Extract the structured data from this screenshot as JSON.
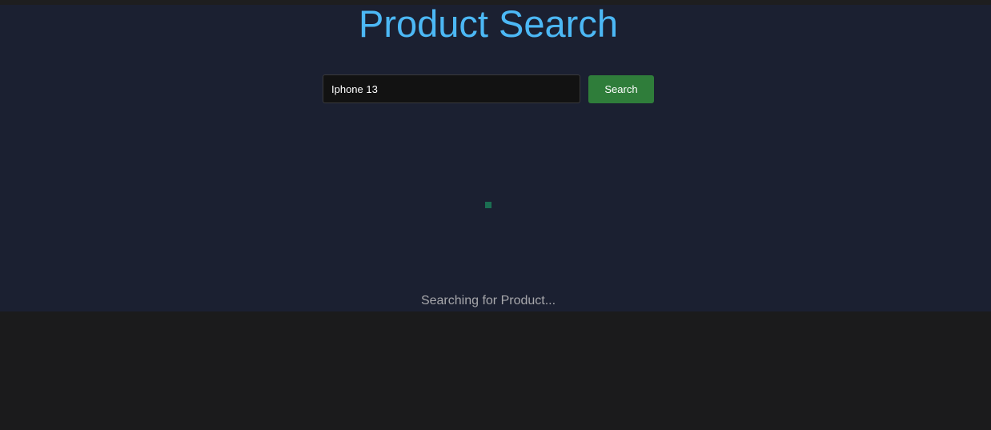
{
  "header": {
    "title": "Product Search"
  },
  "search": {
    "value": "Iphone 13",
    "button_label": "Search"
  },
  "status": {
    "text": "Searching for Product..."
  },
  "colors": {
    "title": "#4cb8f5",
    "panel_background": "#1b2031",
    "page_background": "#1b1b1c",
    "button": "#2f7d3a",
    "spinner": "#1b6e52",
    "status_text": "#a7a7ab"
  },
  "icons": {
    "loading": "loading-spinner-icon"
  }
}
